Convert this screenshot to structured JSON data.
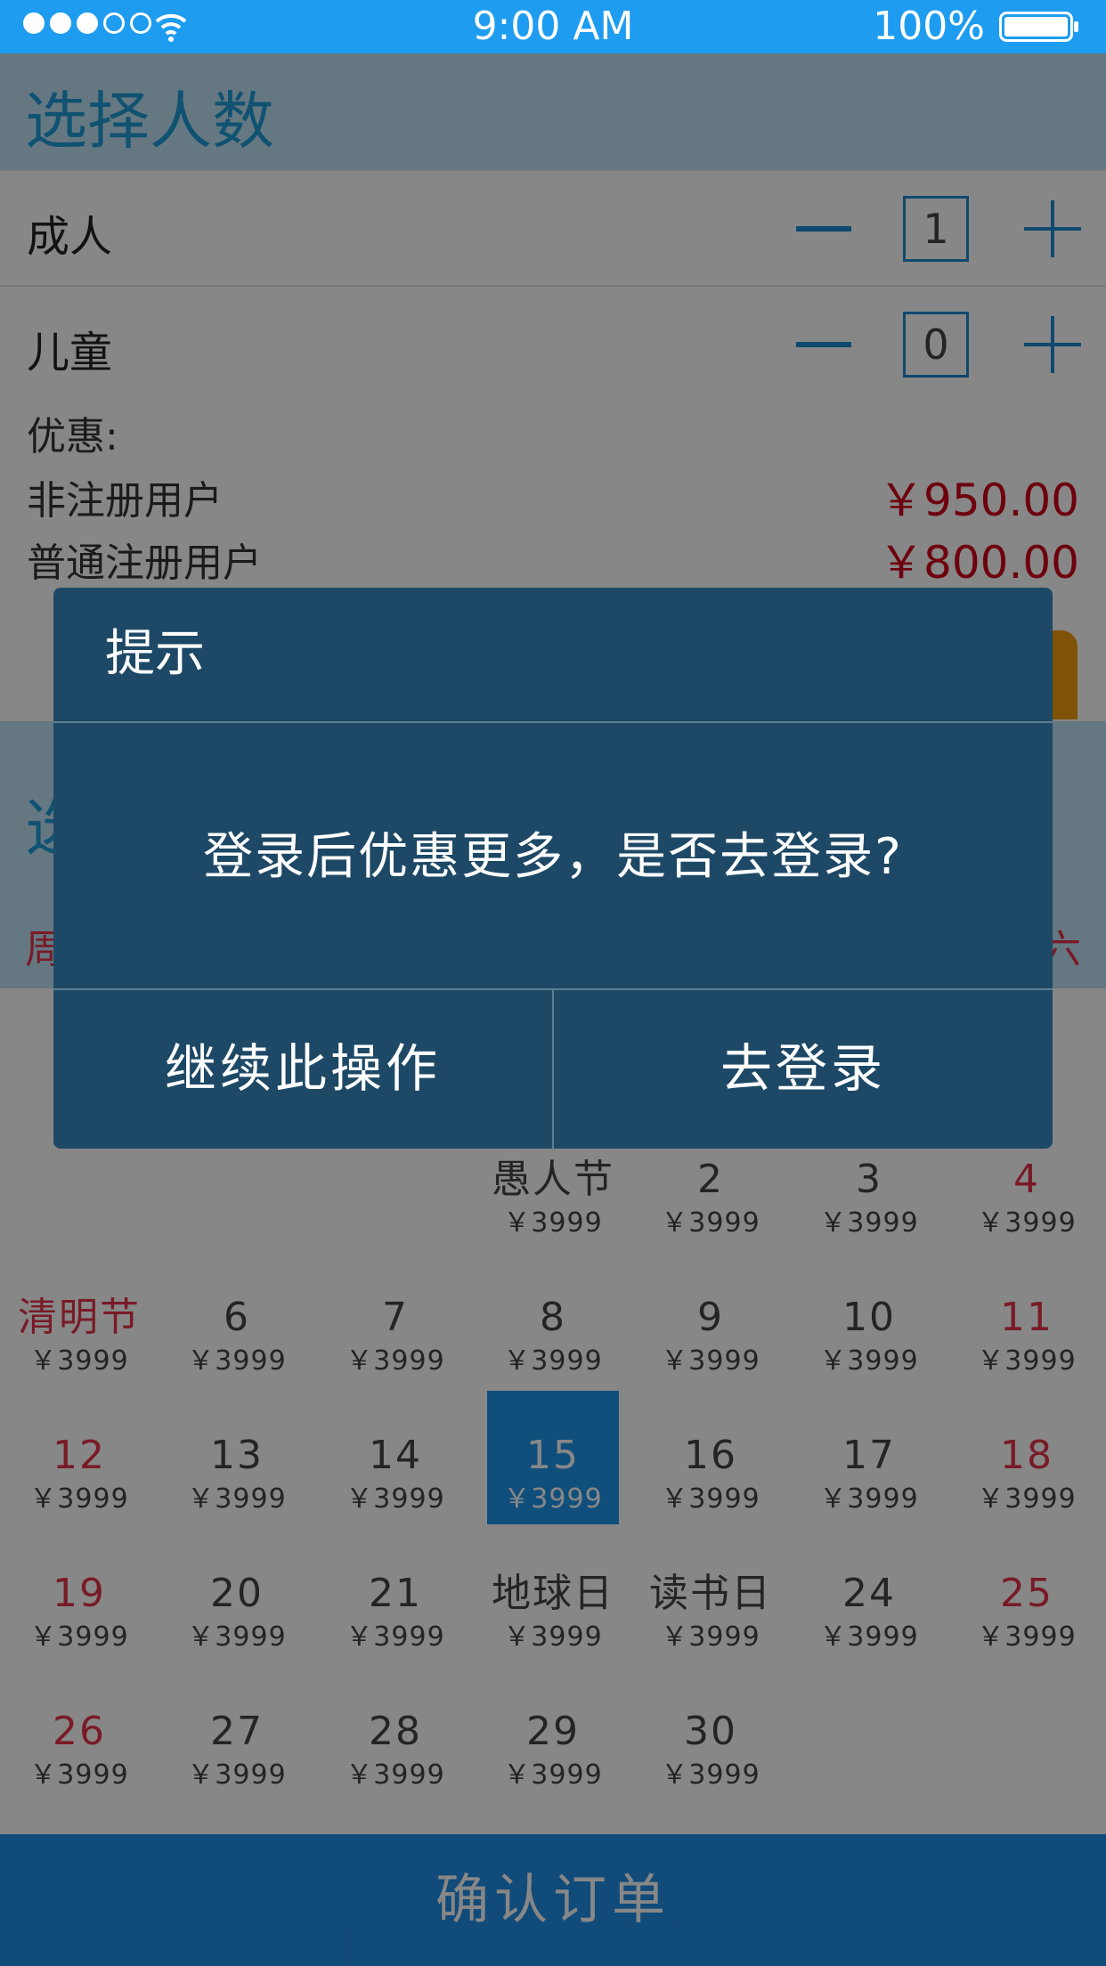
{
  "status_bar": {
    "time": "9:00 AM",
    "battery": "100%",
    "signal_dots": [
      true,
      true,
      true,
      false,
      false
    ]
  },
  "people": {
    "title": "选择人数",
    "adult_label": "成人",
    "adult_qty": "1",
    "child_label": "儿童",
    "child_qty": "0"
  },
  "promo": {
    "heading": "优惠:",
    "rows": [
      {
        "label": "非注册用户",
        "price": "￥950.00"
      },
      {
        "label": "普通注册用户",
        "price": "￥800.00"
      }
    ]
  },
  "partial": {
    "date_title": "选",
    "weekday_start": "周",
    "weekday_end": "六"
  },
  "calendar": {
    "weeks": [
      [
        null,
        null,
        null,
        {
          "day": "愚人节",
          "price": "￥3999"
        },
        {
          "day": "2",
          "price": "￥3999"
        },
        {
          "day": "3",
          "price": "￥3999"
        },
        {
          "day": "4",
          "price": "￥3999",
          "red": true
        }
      ],
      [
        {
          "day": "清明节",
          "price": "￥3999",
          "red": true
        },
        {
          "day": "6",
          "price": "￥3999"
        },
        {
          "day": "7",
          "price": "￥3999"
        },
        {
          "day": "8",
          "price": "￥3999"
        },
        {
          "day": "9",
          "price": "￥3999"
        },
        {
          "day": "10",
          "price": "￥3999"
        },
        {
          "day": "11",
          "price": "￥3999",
          "red": true
        }
      ],
      [
        {
          "day": "12",
          "price": "￥3999",
          "red": true
        },
        {
          "day": "13",
          "price": "￥3999"
        },
        {
          "day": "14",
          "price": "￥3999"
        },
        {
          "day": "15",
          "price": "￥3999",
          "selected": true
        },
        {
          "day": "16",
          "price": "￥3999"
        },
        {
          "day": "17",
          "price": "￥3999"
        },
        {
          "day": "18",
          "price": "￥3999",
          "red": true
        }
      ],
      [
        {
          "day": "19",
          "price": "￥3999",
          "red": true
        },
        {
          "day": "20",
          "price": "￥3999"
        },
        {
          "day": "21",
          "price": "￥3999"
        },
        {
          "day": "地球日",
          "price": "￥3999"
        },
        {
          "day": "读书日",
          "price": "￥3999"
        },
        {
          "day": "24",
          "price": "￥3999"
        },
        {
          "day": "25",
          "price": "￥3999",
          "red": true
        }
      ],
      [
        {
          "day": "26",
          "price": "￥3999",
          "red": true
        },
        {
          "day": "27",
          "price": "￥3999"
        },
        {
          "day": "28",
          "price": "￥3999"
        },
        {
          "day": "29",
          "price": "￥3999"
        },
        {
          "day": "30",
          "price": "￥3999"
        },
        null,
        null
      ]
    ]
  },
  "confirm_label": "确认订单",
  "dialog": {
    "title": "提示",
    "message": "登录后优惠更多，是否去登录?",
    "continue_label": "继续此操作",
    "login_label": "去登录"
  },
  "colors": {
    "status_bar": "#1e9cf0",
    "accent": "#1e8bd2",
    "price_red": "#d0021b",
    "weekend_red": "#e3344a",
    "dialog_bg": "#1e4966",
    "confirm_bg": "#1f8fe6"
  }
}
